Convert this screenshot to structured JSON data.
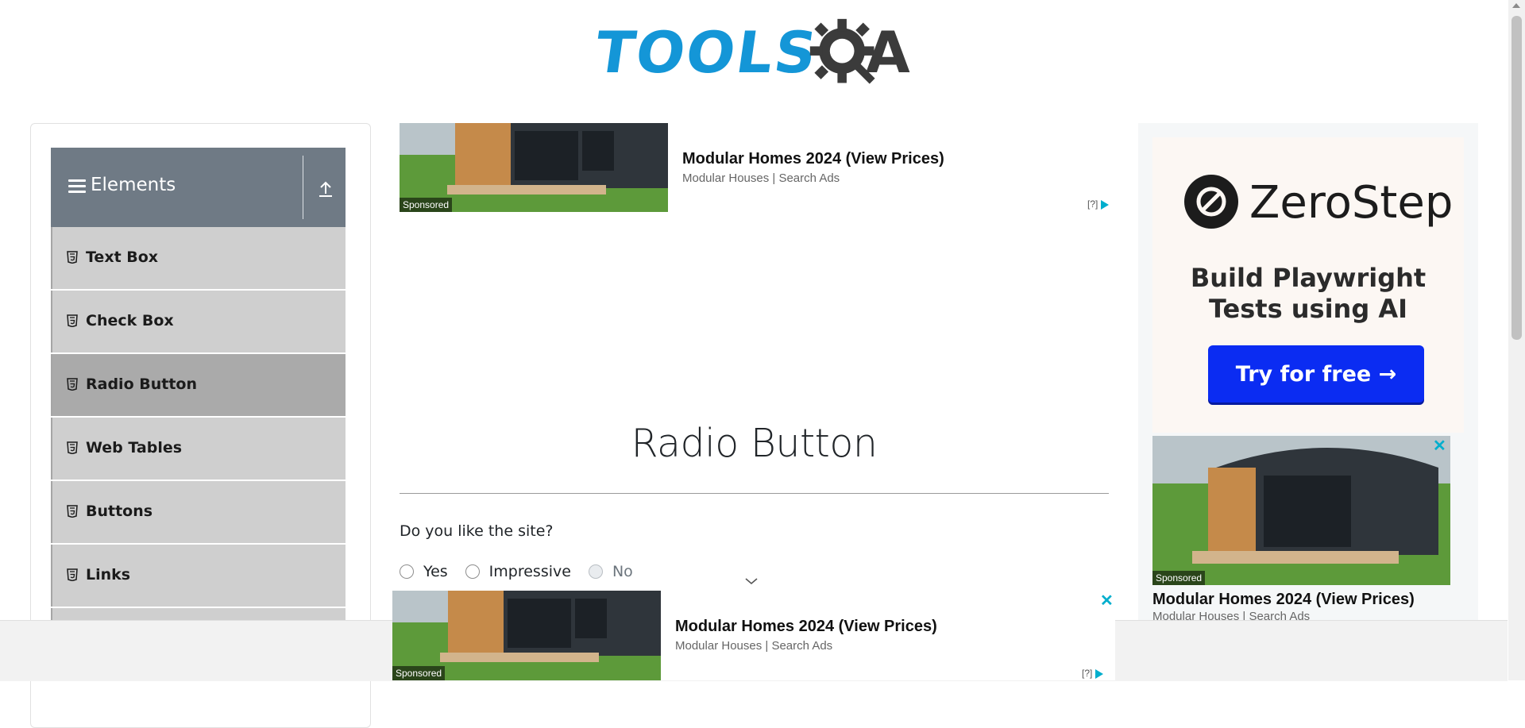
{
  "logo": {
    "part1": "TOOLS",
    "part2": "A"
  },
  "sidebar": {
    "group_title": "Elements",
    "items": [
      {
        "label": "Text Box"
      },
      {
        "label": "Check Box"
      },
      {
        "label": "Radio Button",
        "active": true
      },
      {
        "label": "Web Tables"
      },
      {
        "label": "Buttons"
      },
      {
        "label": "Links"
      }
    ]
  },
  "ad_top": {
    "title": "Modular Homes 2024 (View Prices)",
    "subtitle": "Modular Houses | Search Ads",
    "sponsored": "Sponsored",
    "adchoices": "[?]"
  },
  "main": {
    "title": "Radio Button",
    "question": "Do you like the site?",
    "options": [
      {
        "label": "Yes",
        "disabled": false
      },
      {
        "label": "Impressive",
        "disabled": false
      },
      {
        "label": "No",
        "disabled": true
      }
    ]
  },
  "ad_right": {
    "brand": "ZeroStep",
    "tagline_line1": "Build Playwright",
    "tagline_line2": "Tests using AI",
    "cta": "Try for free →",
    "sponsored": "Sponsored",
    "title": "Modular Homes 2024 (View Prices)",
    "subtitle": "Modular Houses | Search Ads",
    "close": "✕"
  },
  "ad_bottom": {
    "title": "Modular Homes 2024 (View Prices)",
    "subtitle": "Modular Houses | Search Ads",
    "sponsored": "Sponsored",
    "adchoices": "[?]",
    "close": "✕"
  },
  "colors": {
    "brand_blue": "#1496d7",
    "sidebar_header": "#6f7a85",
    "cta_blue": "#0b2cf2",
    "adchoice_teal": "#00aecd"
  }
}
